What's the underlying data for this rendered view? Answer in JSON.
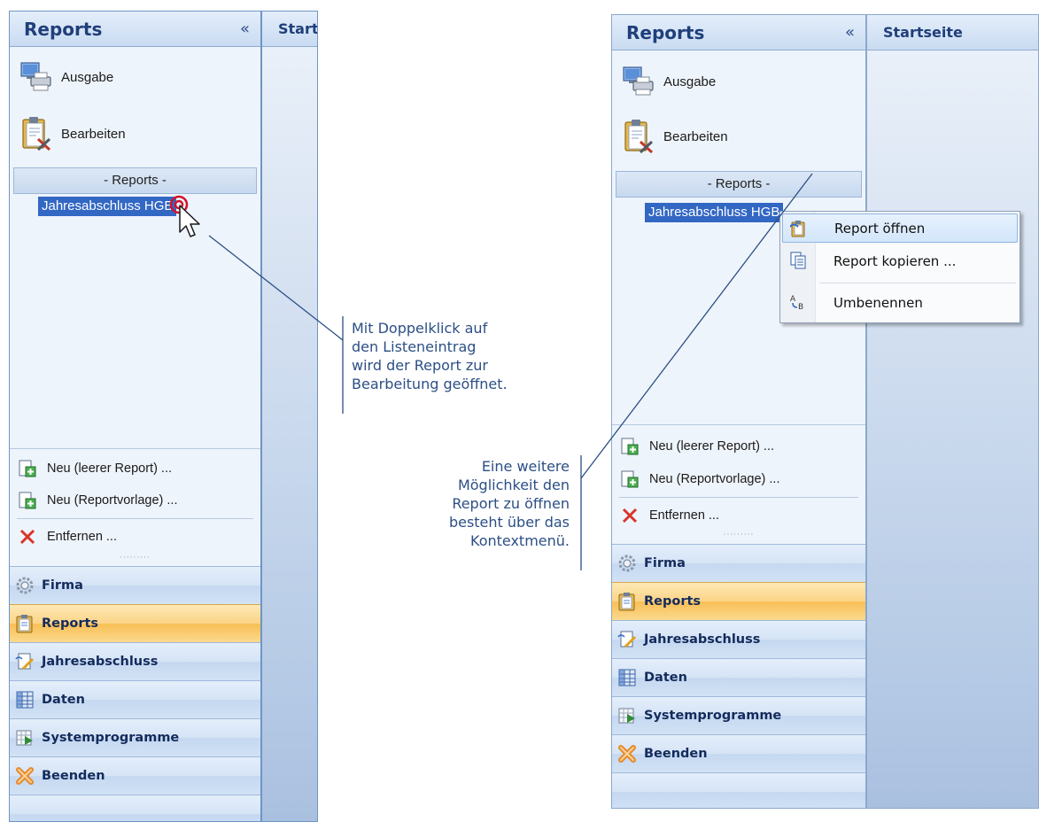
{
  "left": {
    "title": "Reports",
    "collapse": "«",
    "actions": [
      {
        "label": "Ausgabe",
        "icon": "computer-printer-icon"
      },
      {
        "label": "Bearbeiten",
        "icon": "clipboard-tools-icon"
      }
    ],
    "section": "- Reports -",
    "list_item": "Jahresabschluss HGB",
    "sub_actions": [
      {
        "label": "Neu  (leerer Report) ...",
        "icon": "new-report-icon"
      },
      {
        "label": "Neu  (Reportvorlage) ...",
        "icon": "new-template-icon"
      },
      {
        "label": "Entfernen ...",
        "icon": "delete-x-icon"
      }
    ],
    "grip": "·········",
    "nav": [
      {
        "label": "Firma",
        "icon": "gear-icon",
        "active": false
      },
      {
        "label": "Reports",
        "icon": "clipboard-icon",
        "active": true
      },
      {
        "label": "Jahresabschluss",
        "icon": "document-edit-icon",
        "active": false
      },
      {
        "label": "Daten",
        "icon": "table-icon",
        "active": false
      },
      {
        "label": "Systemprogramme",
        "icon": "system-programs-icon",
        "active": false
      },
      {
        "label": "Beenden",
        "icon": "exit-icon",
        "active": false
      }
    ],
    "content_title": "Startseite"
  },
  "right": {
    "title": "Reports",
    "collapse": "«",
    "actions": [
      {
        "label": "Ausgabe",
        "icon": "computer-printer-icon"
      },
      {
        "label": "Bearbeiten",
        "icon": "clipboard-tools-icon"
      }
    ],
    "section": "- Reports -",
    "list_item": "Jahresabschluss HGB",
    "sub_actions": [
      {
        "label": "Neu  (leerer Report) ...",
        "icon": "new-report-icon"
      },
      {
        "label": "Neu  (Reportvorlage) ...",
        "icon": "new-template-icon"
      },
      {
        "label": "Entfernen ...",
        "icon": "delete-x-icon"
      }
    ],
    "grip": "·········",
    "nav": [
      {
        "label": "Firma",
        "icon": "gear-icon",
        "active": false
      },
      {
        "label": "Reports",
        "icon": "clipboard-icon",
        "active": true
      },
      {
        "label": "Jahresabschluss",
        "icon": "document-edit-icon",
        "active": false
      },
      {
        "label": "Daten",
        "icon": "table-icon",
        "active": false
      },
      {
        "label": "Systemprogramme",
        "icon": "system-programs-icon",
        "active": false
      },
      {
        "label": "Beenden",
        "icon": "exit-icon",
        "active": false
      }
    ],
    "content_title": "Startseite"
  },
  "context_menu": {
    "items": [
      {
        "label": "Report öffnen",
        "icon": "open-report-icon"
      },
      {
        "label": "Report kopieren ...",
        "icon": "copy-report-icon"
      },
      {
        "label": "Umbenennen",
        "icon": "rename-icon"
      }
    ]
  },
  "annotations": {
    "first": [
      "Mit Doppelklick auf",
      "den Listeneintrag",
      "wird der Report zur",
      "Bearbeitung geöffnet."
    ],
    "second": [
      "Eine weitere",
      "Möglichkeit den",
      "Report zu öffnen",
      "besteht über das",
      "Kontextmenü."
    ]
  },
  "colors": {
    "accent": "#3267c4",
    "active_nav": "#f8bf56",
    "annotation": "#2c4f85"
  }
}
